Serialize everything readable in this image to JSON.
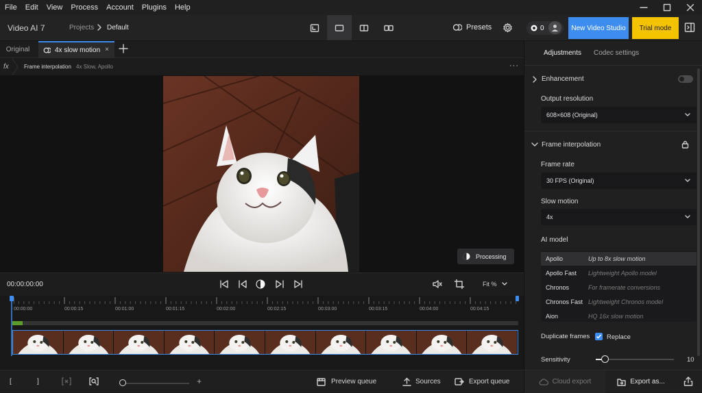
{
  "menu": [
    "File",
    "Edit",
    "View",
    "Process",
    "Account",
    "Plugins",
    "Help"
  ],
  "header": {
    "app_title": "Video AI  7",
    "crumb_projects": "Projects",
    "crumb_current": "Default",
    "presets_label": "Presets",
    "credits": "0",
    "new_studio_label": "New Video Studio",
    "trial_label": "Trial mode"
  },
  "tabs": {
    "original": "Original",
    "active": "4x slow motion",
    "close": "×"
  },
  "filter": {
    "icon": "fx",
    "label": "Frame interpolation",
    "detail": "4x Slow, Apollo",
    "more": "···"
  },
  "preview": {
    "processing_label": "Processing"
  },
  "transport": {
    "timecode": "00:00:00:00",
    "fit_label": "Fit %"
  },
  "timeline": {
    "ruler_labels": [
      "00:00:00",
      "00:00:15",
      "00:01:00",
      "00:01:15",
      "00:02:00",
      "00:02:15",
      "00:03:00",
      "00:03:15",
      "00:04:00",
      "00:04:15"
    ],
    "progress": 0.02,
    "frame_count": 10
  },
  "bottom": {
    "mark_in": "[",
    "mark_out": "]",
    "zoom_plus": "+",
    "preview_queue": "Preview queue",
    "sources": "Sources",
    "export_queue": "Export queue"
  },
  "right_panel": {
    "tab_adjustments": "Adjustments",
    "tab_codec": "Codec settings",
    "enhancement_title": "Enhancement",
    "enhancement_enabled": false,
    "output_resolution_label": "Output resolution",
    "output_resolution_value": "608×608 (Original)",
    "frame_interp_title": "Frame interpolation",
    "frame_rate_label": "Frame rate",
    "frame_rate_value": "30 FPS (Original)",
    "slow_motion_label": "Slow motion",
    "slow_motion_value": "4x",
    "ai_model_label": "AI model",
    "models": [
      {
        "name": "Apollo",
        "desc": "Up to 8x slow motion",
        "selected": true
      },
      {
        "name": "Apollo Fast",
        "desc": "Lightweight Apollo model",
        "selected": false
      },
      {
        "name": "Chronos",
        "desc": "For framerate conversions",
        "selected": false
      },
      {
        "name": "Chronos Fast",
        "desc": "Lightweight Chronos model",
        "selected": false
      },
      {
        "name": "Aion",
        "desc": "HQ 16x slow motion",
        "selected": false
      }
    ],
    "duplicate_frames_label": "Duplicate frames",
    "replace_label": "Replace",
    "replace_checked": true,
    "sensitivity_label": "Sensitivity",
    "sensitivity_value": "10",
    "cloud_export_label": "Cloud export",
    "export_as_label": "Export as..."
  },
  "colors": {
    "accent": "#3d8df0",
    "trial": "#f5c400",
    "progress_green": "#5b9c2b"
  }
}
